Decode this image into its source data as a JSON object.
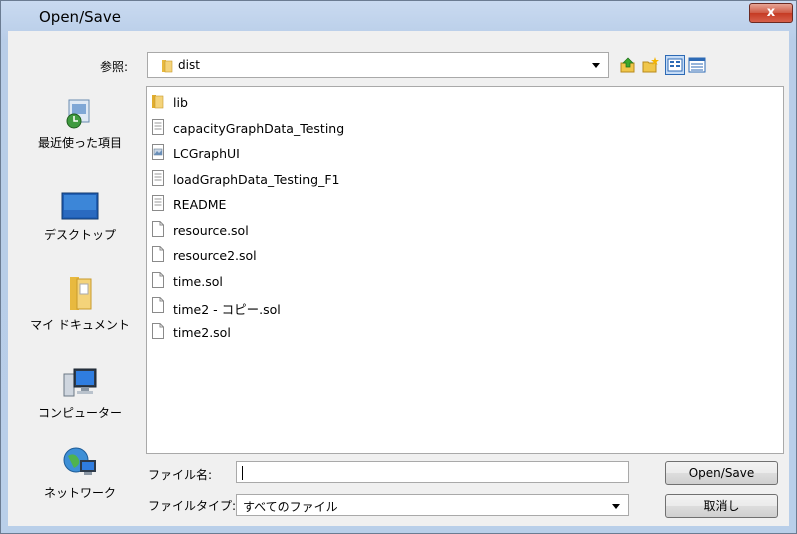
{
  "window": {
    "title": "Open/Save",
    "close_glyph": "x"
  },
  "lookin": {
    "label": "参照:",
    "value": "dist"
  },
  "toolbar": [
    "up-folder-icon",
    "new-folder-icon",
    "view-list-icon",
    "view-details-icon"
  ],
  "places": [
    {
      "name": "recent",
      "label": "最近使った項目",
      "icon": "recent-items-icon"
    },
    {
      "name": "desktop",
      "label": "デスクトップ",
      "icon": "desktop-icon"
    },
    {
      "name": "documents",
      "label": "マイ ドキュメント",
      "icon": "documents-icon"
    },
    {
      "name": "computer",
      "label": "コンピューター",
      "icon": "computer-icon"
    },
    {
      "name": "network",
      "label": "ネットワーク",
      "icon": "network-icon"
    }
  ],
  "files": [
    {
      "name": "lib",
      "type": "folder"
    },
    {
      "name": "capacityGraphData_Testing",
      "type": "text"
    },
    {
      "name": "LCGraphUI",
      "type": "image"
    },
    {
      "name": "loadGraphData_Testing_F1",
      "type": "text"
    },
    {
      "name": "README",
      "type": "text"
    },
    {
      "name": "resource.sol",
      "type": "file"
    },
    {
      "name": "resource2.sol",
      "type": "file"
    },
    {
      "name": "time.sol",
      "type": "file"
    },
    {
      "name": "time2 - コピー.sol",
      "type": "file"
    },
    {
      "name": "time2.sol",
      "type": "file"
    }
  ],
  "filename": {
    "label": "ファイル名:",
    "value": ""
  },
  "filetype": {
    "label": "ファイルタイプ:",
    "value": "すべてのファイル"
  },
  "buttons": {
    "ok": "Open/Save",
    "cancel": "取消し"
  }
}
